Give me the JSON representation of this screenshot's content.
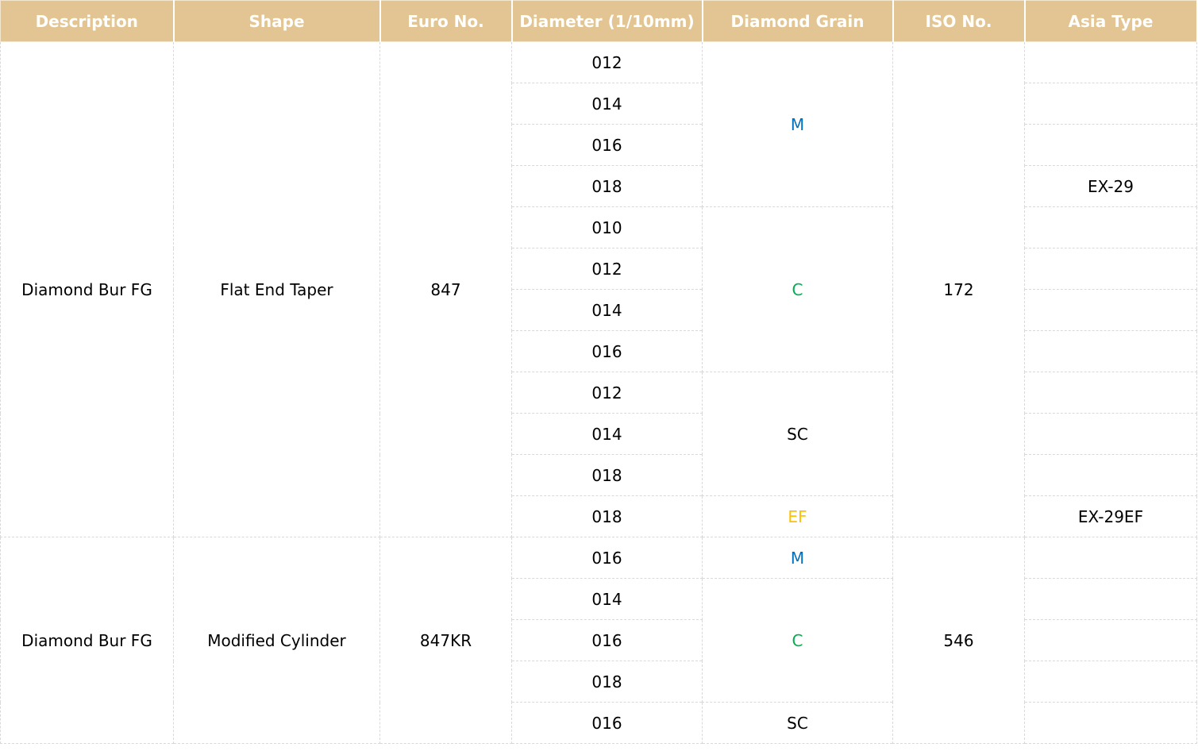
{
  "columns": [
    "Description",
    "Shape",
    "Euro No.",
    "Diameter (1/10mm)",
    "Diamond Grain",
    "ISO No.",
    "Asia Type"
  ],
  "groups": [
    {
      "description": "Diamond Bur FG",
      "shape": "Flat End Taper",
      "euro_no": "847",
      "iso_no": "172",
      "diameters": [
        "012",
        "014",
        "016",
        "018",
        "010",
        "012",
        "014",
        "016",
        "012",
        "014",
        "018",
        "018"
      ],
      "grains": [
        {
          "label": "M",
          "span": 4
        },
        {
          "label": "C",
          "span": 4
        },
        {
          "label": "SC",
          "span": 3
        },
        {
          "label": "EF",
          "span": 1
        }
      ],
      "asia_types": [
        "",
        "",
        "",
        "EX-29",
        "",
        "",
        "",
        "",
        "",
        "",
        "",
        "EX-29EF"
      ]
    },
    {
      "description": "Diamond Bur FG",
      "shape": "Modified Cylinder",
      "euro_no": "847KR",
      "iso_no": "546",
      "diameters": [
        "016",
        "014",
        "016",
        "018",
        "016"
      ],
      "grains": [
        {
          "label": "M",
          "span": 1
        },
        {
          "label": "C",
          "span": 3
        },
        {
          "label": "SC",
          "span": 1
        }
      ],
      "asia_types": [
        "",
        "",
        "",
        "",
        ""
      ]
    }
  ],
  "grain_colors": {
    "M": "#0070C0",
    "C": "#00B050",
    "SC": "#000000",
    "EF": "#FFC000"
  },
  "header_color": "#E2C592"
}
